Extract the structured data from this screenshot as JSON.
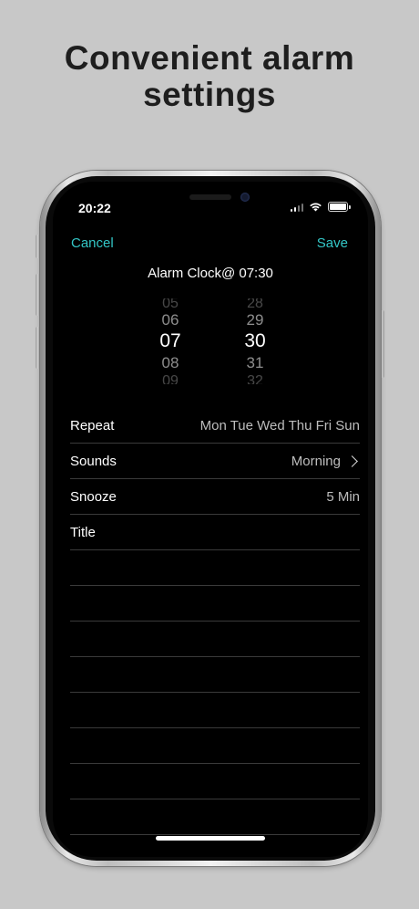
{
  "headline": {
    "line1": "Convenient alarm",
    "line2": "settings"
  },
  "status_bar": {
    "time": "20:22",
    "icons": [
      "signal-icon",
      "wifi-icon",
      "battery-icon"
    ]
  },
  "nav": {
    "cancel_label": "Cancel",
    "save_label": "Save",
    "title": "Alarm Clock@ 07:30"
  },
  "picker": {
    "hours": [
      "05",
      "06",
      "07",
      "08",
      "09"
    ],
    "minutes": [
      "28",
      "29",
      "30",
      "31",
      "32"
    ],
    "selected_hour": "07",
    "selected_minute": "30"
  },
  "settings": {
    "repeat": {
      "label": "Repeat",
      "value": "Mon Tue Wed Thu Fri Sun"
    },
    "sounds": {
      "label": "Sounds",
      "value": "Morning"
    },
    "snooze": {
      "label": "Snooze",
      "value": "5 Min"
    },
    "title": {
      "label": "Title",
      "value": ""
    }
  },
  "colors": {
    "background": "#c8c8c8",
    "accent": "#33c6c6",
    "screen": "#000000",
    "separator": "#3a3a3a"
  }
}
